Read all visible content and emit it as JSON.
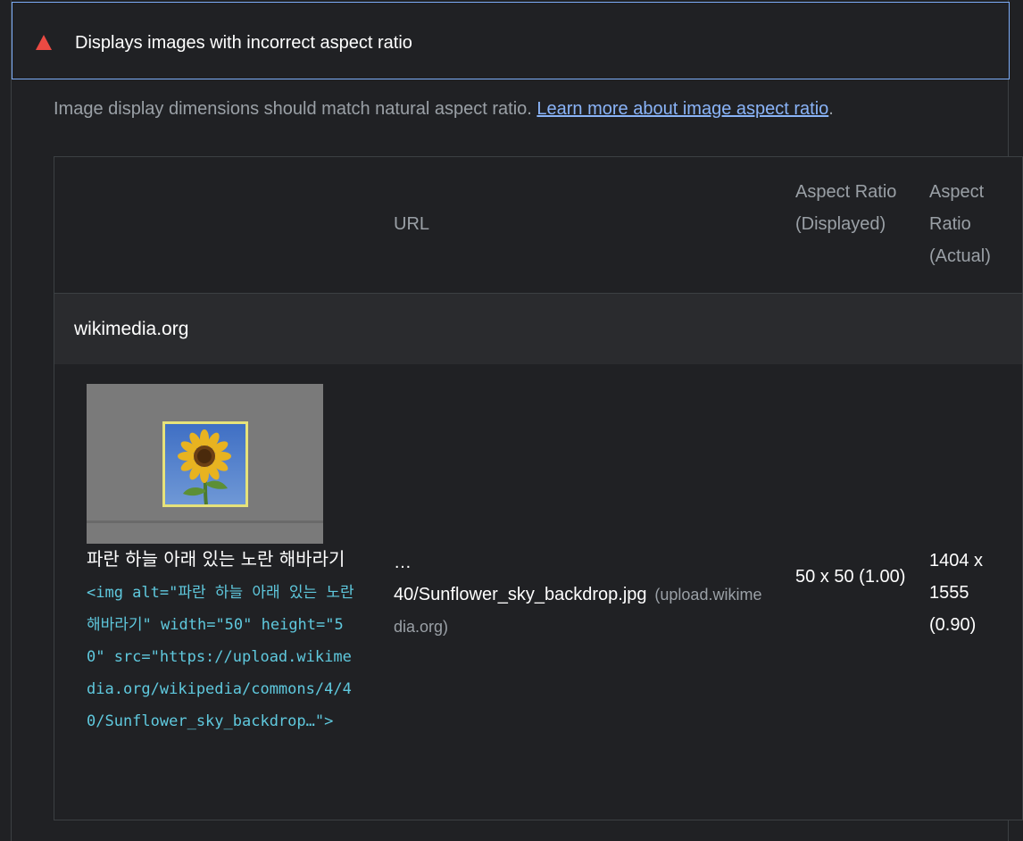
{
  "audit": {
    "title": "Displays images with incorrect aspect ratio",
    "status_icon": "warning-triangle-icon",
    "fail_color": "#eb4a43",
    "toggle_icon": "chevron-up-icon",
    "description": "Image display dimensions should match natural aspect ratio. ",
    "learn_more_link": "Learn more about image aspect ratio",
    "description_end": "."
  },
  "table": {
    "headers": {
      "url": "URL",
      "aspect_displayed": "Aspect Ratio (Displayed)",
      "aspect_actual": "Aspect Ratio (Actual)"
    },
    "groups": [
      {
        "label": "wikimedia.org",
        "rows": [
          {
            "node_label": "파란 하늘 아래 있는 노란 해바라기",
            "snippet": "<img alt=\"파란 하늘 아래 있는 노란 해바라기\" width=\"50\" height=\"50\" src=\"https://upload.wikimedia.org/wikipedia/commons/4/40/Sunflower_sky_backdrop…\">",
            "url_ellipsis": "…",
            "url_path": "40/Sunflower_sky_backdrop.jpg",
            "url_host": "(upload.wikimedia.org)",
            "aspect_displayed": "50 x 50 (1.00)",
            "aspect_actual": "1404 x 1555 (0.90)"
          }
        ]
      }
    ]
  },
  "colors": {
    "background": "#202124",
    "link": "#8ab4f8",
    "code": "#5fc9de",
    "focus_border": "#7cacf8",
    "highlight_frame": "#e6e27a"
  }
}
